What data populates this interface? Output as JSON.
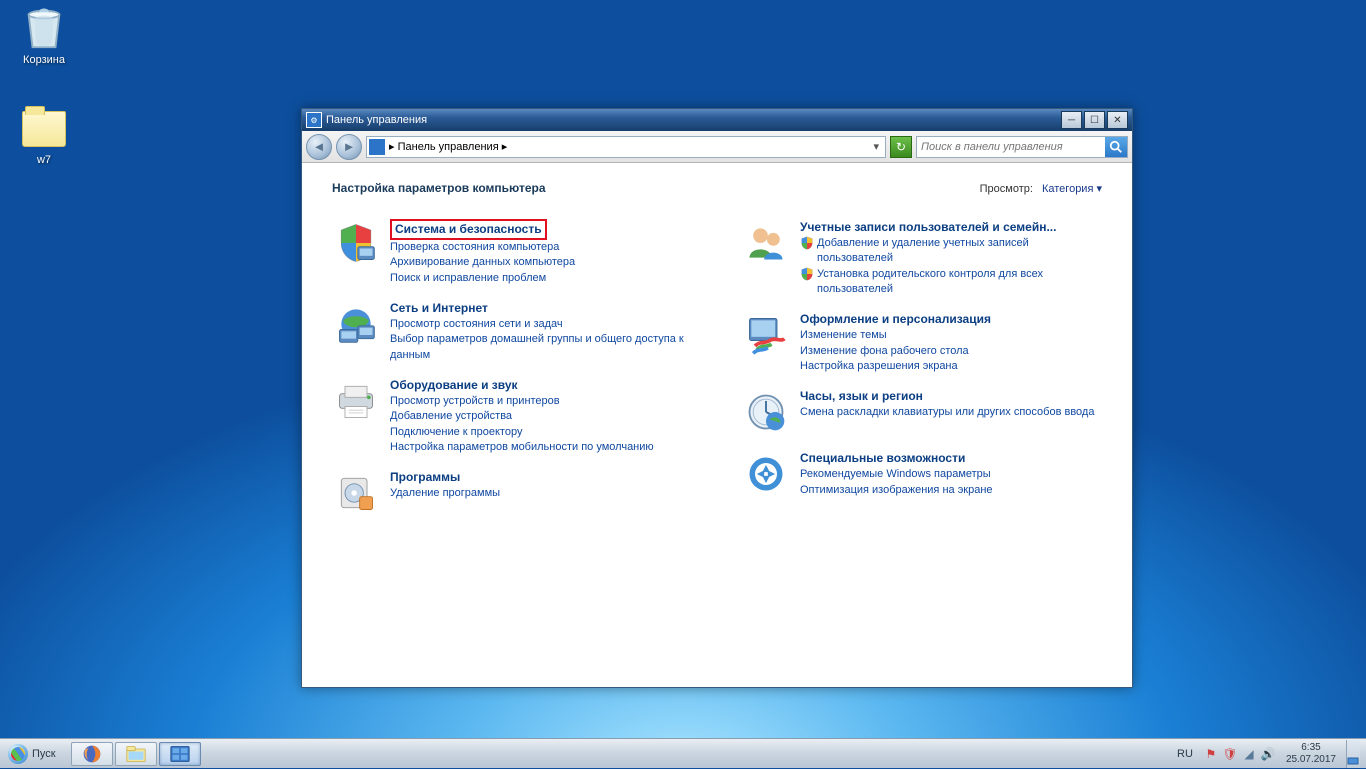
{
  "desktop": {
    "recycle_bin": "Корзина",
    "folder_w7": "w7"
  },
  "window": {
    "title": "Панель управления",
    "breadcrumb_sep": "▸",
    "breadcrumb": "Панель управления",
    "search_placeholder": "Поиск в панели управления",
    "heading": "Настройка параметров компьютера",
    "view_label": "Просмотр:",
    "view_value": "Категория",
    "categories_left": [
      {
        "title": "Система и безопасность",
        "highlighted": true,
        "links": [
          {
            "text": "Проверка состояния компьютера"
          },
          {
            "text": "Архивирование данных компьютера"
          },
          {
            "text": "Поиск и исправление проблем"
          }
        ]
      },
      {
        "title": "Сеть и Интернет",
        "links": [
          {
            "text": "Просмотр состояния сети и задач"
          },
          {
            "text": "Выбор параметров домашней группы и общего доступа к данным"
          }
        ]
      },
      {
        "title": "Оборудование и звук",
        "links": [
          {
            "text": "Просмотр устройств и принтеров"
          },
          {
            "text": "Добавление устройства"
          },
          {
            "text": "Подключение к проектору"
          },
          {
            "text": "Настройка параметров мобильности по умолчанию"
          }
        ]
      },
      {
        "title": "Программы",
        "links": [
          {
            "text": "Удаление программы"
          }
        ]
      }
    ],
    "categories_right": [
      {
        "title": "Учетные записи пользователей и семейн...",
        "links": [
          {
            "shield": true,
            "text": "Добавление и удаление учетных записей пользователей"
          },
          {
            "shield": true,
            "text": "Установка родительского контроля для всех пользователей"
          }
        ]
      },
      {
        "title": "Оформление и персонализация",
        "links": [
          {
            "text": "Изменение темы"
          },
          {
            "text": "Изменение фона рабочего стола"
          },
          {
            "text": "Настройка разрешения экрана"
          }
        ]
      },
      {
        "title": "Часы, язык и регион",
        "links": [
          {
            "text": "Смена раскладки клавиатуры или других способов ввода"
          }
        ]
      },
      {
        "title": "Специальные возможности",
        "links": [
          {
            "text": "Рекомендуемые Windows параметры"
          },
          {
            "text": "Оптимизация изображения на экране"
          }
        ]
      }
    ]
  },
  "taskbar": {
    "start": "Пуск",
    "lang": "RU",
    "time": "6:35",
    "date": "25.07.2017"
  }
}
